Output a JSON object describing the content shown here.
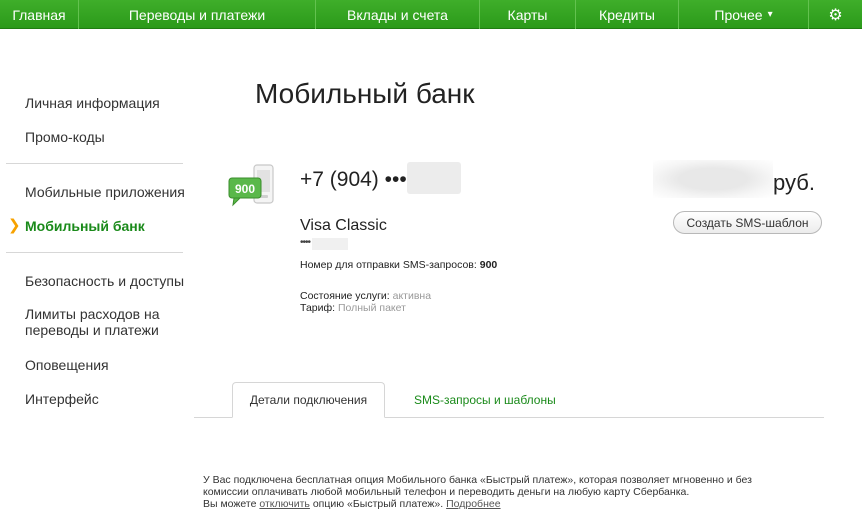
{
  "nav": {
    "items": [
      "Главная",
      "Переводы и платежи",
      "Вклады и счета",
      "Карты",
      "Кредиты",
      "Прочее"
    ],
    "more_arrow": "▾",
    "settings_icon": "gear-icon"
  },
  "sidebar": {
    "items": [
      {
        "label": "Личная информация"
      },
      {
        "label": "Промо-коды"
      },
      {
        "label": "Мобильные приложения"
      },
      {
        "label": "Мобильный банк"
      },
      {
        "label": "Безопасность и доступы"
      },
      {
        "label": "Лимиты расходов на переводы и платежи"
      },
      {
        "label": "Оповещения"
      },
      {
        "label": "Интерфейс"
      }
    ],
    "active_marker": "❯"
  },
  "main": {
    "title": "Мобильный банк",
    "icon_number": "900",
    "phone": "+7 (904) •••",
    "balance_unit": "руб.",
    "create_template_button": "Создать SMS-шаблон",
    "card_name": "Visa Classic",
    "card_number": "••••",
    "sms_number_label": "Номер для отправки SMS-запросов:",
    "sms_number_value": "900",
    "status_label": "Состояние услуги:",
    "status_value": "активна",
    "tariff_label": "Тариф:",
    "tariff_value": "Полный пакет"
  },
  "tabs": {
    "active": "Детали подключения",
    "inactive": "SMS-запросы и шаблоны"
  },
  "info": {
    "line1": "У Вас подключена бесплатная опция Мобильного банка «Быстрый платеж», которая позволяет мгновенно и без",
    "line2": "комиссии оплачивать любой мобильный телефон и переводить деньги на любую карту Сбербанка.",
    "line3_prefix": "Вы можете",
    "line3_link": "отключить",
    "line3_middle": "опцию «Быстрый платеж».",
    "line3_more": "Подробнее"
  },
  "colors": {
    "nav_green": "#2b9a1a",
    "link_green": "#1a8a1a",
    "active_arrow": "#f7a200"
  }
}
